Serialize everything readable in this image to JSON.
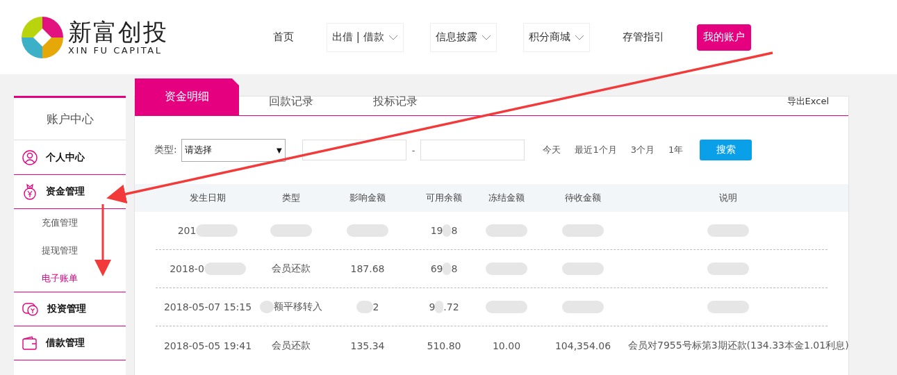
{
  "logo": {
    "name": "新富创投",
    "subtitle": "XIN FU CAPITAL"
  },
  "nav": [
    {
      "label": "首页",
      "kind": "link",
      "selected": false
    },
    {
      "label": "出借 | 借款",
      "kind": "dropdown",
      "selected": false
    },
    {
      "label": "信息披露",
      "kind": "dropdown",
      "selected": false
    },
    {
      "label": "积分商城",
      "kind": "dropdown",
      "selected": false
    },
    {
      "label": "存管指引",
      "kind": "link",
      "selected": false
    },
    {
      "label": "我的账户",
      "kind": "link",
      "selected": true
    }
  ],
  "sidebar": {
    "title": "账户中心",
    "items": [
      {
        "label": "个人中心"
      },
      {
        "label": "资金管理",
        "children": [
          {
            "label": "充值管理",
            "selected": false
          },
          {
            "label": "提现管理",
            "selected": false
          },
          {
            "label": "电子账单",
            "selected": true
          }
        ]
      },
      {
        "label": "投资管理"
      },
      {
        "label": "借款管理"
      }
    ]
  },
  "tabs": [
    {
      "label": "资金明细",
      "selected": true
    },
    {
      "label": "回款记录",
      "selected": false
    },
    {
      "label": "投标记录",
      "selected": false
    }
  ],
  "export_link": "导出Excel",
  "filter": {
    "type_label": "类型:",
    "type_value": "请选择",
    "select_arrow": "▼",
    "date_separator": "-",
    "periods": [
      "今天",
      "最近1个月",
      "3个月",
      "1年"
    ],
    "search_button": "搜索"
  },
  "table": {
    "columns": [
      "发生日期",
      "类型",
      "影响金额",
      "可用余额",
      "冻结金额",
      "待收金额",
      "说明"
    ],
    "rows": [
      [
        {
          "parts": [
            "201"
          ],
          "blur_end": true
        },
        {
          "blur_end": true
        },
        {
          "blur_end": true
        },
        {
          "parts": [
            "19",
            "8"
          ]
        },
        {
          "blur_end": true
        },
        {
          "blur_end": true
        },
        {
          "blur_end": true
        }
      ],
      [
        {
          "parts": [
            "2018-0"
          ],
          "blur_end": true
        },
        {
          "parts": [
            "会员还款"
          ]
        },
        {
          "parts": [
            "187.68"
          ]
        },
        {
          "parts": [
            "69",
            "8"
          ]
        },
        {
          "blur_end": true
        },
        {
          "blur_end": true
        },
        {
          "blur_end": true
        }
      ],
      [
        {
          "parts": [
            "2018-05-07 15:15"
          ]
        },
        {
          "parts": [
            "额平移转入"
          ],
          "blur_start": true
        },
        {
          "parts": [
            "2"
          ],
          "blur_start": true
        },
        {
          "parts": [
            "9",
            ".72"
          ]
        },
        {
          "blur_end": true
        },
        {
          "blur_end": true
        },
        {
          "blur_end": true
        }
      ],
      [
        {
          "parts": [
            "2018-05-05 19:41"
          ]
        },
        {
          "parts": [
            "会员还款"
          ]
        },
        {
          "parts": [
            "135.34"
          ]
        },
        {
          "parts": [
            "510.80"
          ]
        },
        {
          "parts": [
            "10.00"
          ]
        },
        {
          "parts": [
            "104,354.06"
          ]
        },
        {
          "parts": [
            "会员对7955号标第3期还款(134.33本金1.01利息)"
          ]
        }
      ]
    ]
  }
}
